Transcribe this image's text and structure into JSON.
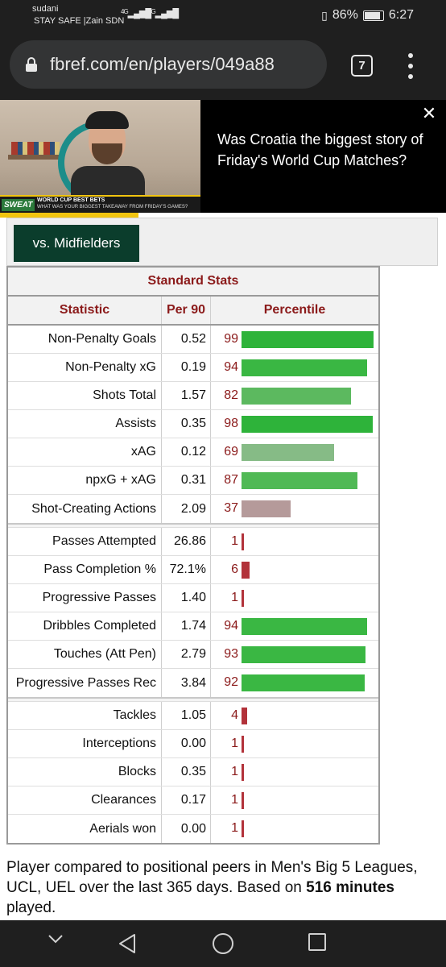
{
  "status_bar": {
    "carrier": "sudani",
    "carrier2": "STAY SAFE |Zain SDN",
    "signal1": "4G",
    "signal2": "3G",
    "battery": "86%",
    "time": "6:27"
  },
  "browser": {
    "url": "fbref.com/en/players/049a88",
    "tab_count": "7"
  },
  "ad": {
    "headline": "Was Croatia the biggest story of Friday's World Cup Matches?",
    "logo": "SWEAT",
    "banner_title": "WORLD CUP BEST BETS",
    "banner_sub": "WHAT WAS YOUR BIGGEST TAKEAWAY FROM FRIDAY'S GAMES?",
    "close": "✕"
  },
  "filter": {
    "label": "vs. Midfielders"
  },
  "table": {
    "caption": "Standard Stats",
    "headers": [
      "Statistic",
      "Per 90",
      "Percentile"
    ],
    "groups": [
      [
        {
          "stat": "Non-Penalty Goals",
          "per90": "0.52",
          "pct": 99,
          "color": "#2eb33a"
        },
        {
          "stat": "Non-Penalty xG",
          "per90": "0.19",
          "pct": 94,
          "color": "#3ab743"
        },
        {
          "stat": "Shots Total",
          "per90": "1.57",
          "pct": 82,
          "color": "#5cb95f"
        },
        {
          "stat": "Assists",
          "per90": "0.35",
          "pct": 98,
          "color": "#2eb33a"
        },
        {
          "stat": "xAG",
          "per90": "0.12",
          "pct": 69,
          "color": "#86bb86"
        },
        {
          "stat": "npxG + xAG",
          "per90": "0.31",
          "pct": 87,
          "color": "#50b955"
        },
        {
          "stat": "Shot-Creating Actions",
          "per90": "2.09",
          "pct": 37,
          "color": "#b59a9a"
        }
      ],
      [
        {
          "stat": "Passes Attempted",
          "per90": "26.86",
          "pct": 1,
          "color": "#b2323a"
        },
        {
          "stat": "Pass Completion %",
          "per90": "72.1%",
          "pct": 6,
          "color": "#b2323a"
        },
        {
          "stat": "Progressive Passes",
          "per90": "1.40",
          "pct": 1,
          "color": "#b2323a"
        },
        {
          "stat": "Dribbles Completed",
          "per90": "1.74",
          "pct": 94,
          "color": "#3ab743"
        },
        {
          "stat": "Touches (Att Pen)",
          "per90": "2.79",
          "pct": 93,
          "color": "#3ab743"
        },
        {
          "stat": "Progressive Passes Rec",
          "per90": "3.84",
          "pct": 92,
          "color": "#3ab743"
        }
      ],
      [
        {
          "stat": "Tackles",
          "per90": "1.05",
          "pct": 4,
          "color": "#b2323a"
        },
        {
          "stat": "Interceptions",
          "per90": "0.00",
          "pct": 1,
          "color": "#b2323a"
        },
        {
          "stat": "Blocks",
          "per90": "0.35",
          "pct": 1,
          "color": "#b2323a"
        },
        {
          "stat": "Clearances",
          "per90": "0.17",
          "pct": 1,
          "color": "#b2323a"
        },
        {
          "stat": "Aerials won",
          "per90": "0.00",
          "pct": 1,
          "color": "#b2323a"
        }
      ]
    ]
  },
  "footnote": {
    "text_before": "Player compared to positional peers in Men's Big 5 Leagues, UCL, UEL over the last 365 days. Based on ",
    "minutes": "516 minutes",
    "text_after": " played."
  },
  "nav_bar": {
    "icons": [
      "chevron-down-icon",
      "back-icon",
      "home-icon",
      "recents-icon"
    ]
  }
}
